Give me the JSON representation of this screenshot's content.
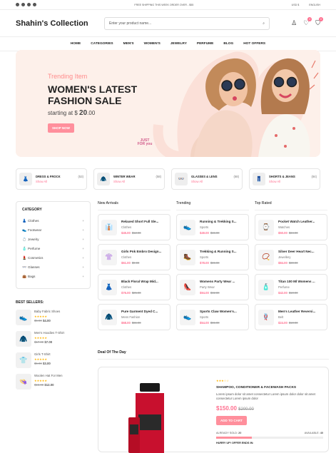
{
  "topbar": {
    "shipping": "FREE SHIPPING THIS WEEK ORDER OVER - $55",
    "currency": "USD $",
    "language": "ENGLISH"
  },
  "header": {
    "logo": "Shahin's Collection",
    "search_placeholder": "Enter your product name...",
    "wishlist_count": "0",
    "cart_count": "0"
  },
  "nav": [
    "HOME",
    "CATEGORIES",
    "MEN'S",
    "WOMEN'S",
    "JEWELRY",
    "PERFUME",
    "BLOG",
    "HOT OFFERS"
  ],
  "hero": {
    "subtitle": "Trending Item",
    "title": "WOMEN'S LATEST FASHION SALE",
    "price_prefix": "starting at $",
    "price": "20",
    "price_dec": ".00",
    "cta": "SHOP NOW",
    "deco": "JUST FOR you"
  },
  "categories": [
    {
      "name": "DRESS & FROCK",
      "count": "(53)",
      "link": "Show All",
      "icon": "dress-icon"
    },
    {
      "name": "WINTER WEAR",
      "count": "(58)",
      "link": "Show All",
      "icon": "coat-icon"
    },
    {
      "name": "GLASSES & LENS",
      "count": "(68)",
      "link": "Show All",
      "icon": "glasses-icon"
    },
    {
      "name": "SHORTS & JEANS",
      "count": "(84)",
      "link": "Show All",
      "icon": "shorts-icon"
    }
  ],
  "sidebar": {
    "title": "CATEGORY",
    "items": [
      "Clothes",
      "Footwear",
      "Jewelry",
      "Perfume",
      "Cosmetics",
      "Glasses",
      "Bags"
    ]
  },
  "best_sellers": {
    "title": "BEST SELLERS:",
    "items": [
      {
        "name": "Baby Fabric Shoes",
        "old": "$5.00",
        "price": "$4.00"
      },
      {
        "name": "Men's Hoodies T-Shirt",
        "old": "$17.00",
        "price": "$7.00"
      },
      {
        "name": "Girls T-Shirt",
        "old": "$5.00",
        "price": "$3.00"
      },
      {
        "name": "Woolen Hat For Men",
        "old": "$15.00",
        "price": "$12.00"
      }
    ]
  },
  "columns": [
    {
      "title": "New Arrivals",
      "items": [
        {
          "name": "Relaxed Short Full Sle...",
          "cat": "Clothes",
          "price": "$45.00",
          "old": "$12.00"
        },
        {
          "name": "Girls Pnk Embro Design...",
          "cat": "Clothes",
          "price": "$61.00",
          "old": "$9.00"
        },
        {
          "name": "Black Floral Wrap Mid...",
          "cat": "Clothes",
          "price": "$76.00",
          "old": "$25.00"
        },
        {
          "name": "Pure Garment Dyed C...",
          "cat": "Mens Fashion",
          "price": "$68.00",
          "old": "$31.00"
        }
      ]
    },
    {
      "title": "Trending",
      "items": [
        {
          "name": "Running & Trekking S...",
          "cat": "Sports",
          "price": "$49.00",
          "old": "$15.00"
        },
        {
          "name": "Trekking & Running S...",
          "cat": "Sports",
          "price": "$78.00",
          "old": "$36.00"
        },
        {
          "name": "Womens Party Wear ...",
          "cat": "Party Wear",
          "price": "$94.00",
          "old": "$42.00"
        },
        {
          "name": "Sports Claw Women's...",
          "cat": "Sports",
          "price": "$54.00",
          "old": "$65.00"
        }
      ]
    },
    {
      "title": "Top Rated",
      "items": [
        {
          "name": "Pocket Watch Leather...",
          "cat": "Watches",
          "price": "$50.00",
          "old": "$34.00"
        },
        {
          "name": "Silver Deer Heart Nec...",
          "cat": "Jewellery",
          "price": "$84.00",
          "old": "$30.00"
        },
        {
          "name": "Titan 100 Ml Womens ...",
          "cat": "Perfume",
          "price": "$42.00",
          "old": "$10.00"
        },
        {
          "name": "Men's Leather Reversi...",
          "cat": "Belt",
          "price": "$24.00",
          "old": "$10.00"
        }
      ]
    }
  ],
  "deal": {
    "title": "Deal Of The Day",
    "product": "SHAMPOO, CONDITIONER & FACEWASH PACKS",
    "desc": "Lorem ipsum dolor sit amet consectetur Lorem ipsum dolor dolor sit amet consectetur Lorem ipsum dolor",
    "price": "$150.00",
    "old": "$200.00",
    "cta": "ADD TO CART",
    "sold_label": "ALREADY SOLD:",
    "sold": "20",
    "avail_label": "AVAILABLE:",
    "avail": "40",
    "hurry": "HURRY UP! OFFER ENDS IN:",
    "progress": 0.33
  }
}
